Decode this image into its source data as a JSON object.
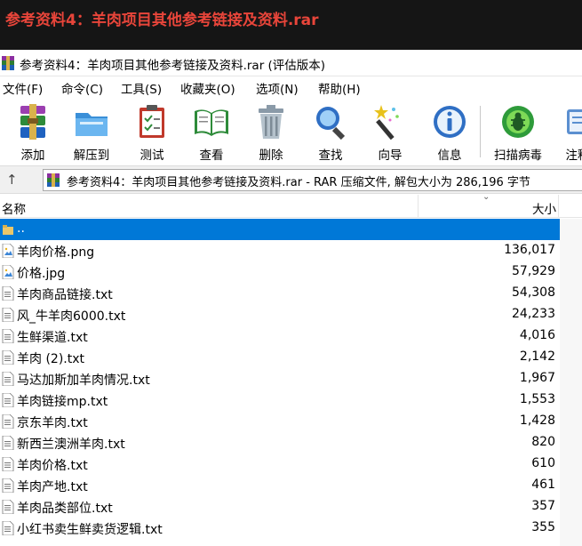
{
  "banner": {
    "title": "参考资料4：羊肉项目其他参考链接及资料.rar"
  },
  "window": {
    "title": "参考资料4：羊肉项目其他参考链接及资料.rar (评估版本)"
  },
  "menu": [
    {
      "label": "文件(F)"
    },
    {
      "label": "命令(C)"
    },
    {
      "label": "工具(S)"
    },
    {
      "label": "收藏夹(O)"
    },
    {
      "label": "选项(N)"
    },
    {
      "label": "帮助(H)"
    }
  ],
  "toolbar": [
    {
      "label": "添加",
      "icon": "add-archive-icon"
    },
    {
      "label": "解压到",
      "icon": "extract-folder-icon"
    },
    {
      "label": "测试",
      "icon": "test-clipboard-icon"
    },
    {
      "label": "查看",
      "icon": "view-book-icon"
    },
    {
      "label": "删除",
      "icon": "delete-trash-icon"
    },
    {
      "label": "查找",
      "icon": "find-magnifier-icon"
    },
    {
      "label": "向导",
      "icon": "wizard-wand-icon"
    },
    {
      "label": "信息",
      "icon": "info-icon"
    },
    {
      "label": "扫描病毒",
      "icon": "scan-virus-bug-icon"
    },
    {
      "label": "注释",
      "icon": "comment-icon"
    }
  ],
  "address": {
    "text": "参考资料4：羊肉项目其他参考链接及资料.rar - RAR 压缩文件, 解包大小为 286,196 字节"
  },
  "columns": {
    "name": "名称",
    "size": "大小"
  },
  "files": [
    {
      "name": "..",
      "size": "",
      "type": "parent"
    },
    {
      "name": "羊肉价格.png",
      "size": "136,017",
      "type": "image"
    },
    {
      "name": "价格.jpg",
      "size": "57,929",
      "type": "image"
    },
    {
      "name": "羊肉商品链接.txt",
      "size": "54,308",
      "type": "text"
    },
    {
      "name": "风_牛羊肉6000.txt",
      "size": "24,233",
      "type": "text"
    },
    {
      "name": "生鲜渠道.txt",
      "size": "4,016",
      "type": "text"
    },
    {
      "name": "羊肉 (2).txt",
      "size": "2,142",
      "type": "text"
    },
    {
      "name": "马达加斯加羊肉情况.txt",
      "size": "1,967",
      "type": "text"
    },
    {
      "name": "羊肉链接mp.txt",
      "size": "1,553",
      "type": "text"
    },
    {
      "name": "京东羊肉.txt",
      "size": "1,428",
      "type": "text"
    },
    {
      "name": "新西兰澳洲羊肉.txt",
      "size": "820",
      "type": "text"
    },
    {
      "name": "羊肉价格.txt",
      "size": "610",
      "type": "text"
    },
    {
      "name": "羊肉产地.txt",
      "size": "461",
      "type": "text"
    },
    {
      "name": "羊肉品类部位.txt",
      "size": "357",
      "type": "text"
    },
    {
      "name": "小红书卖生鲜卖货逻辑.txt",
      "size": "355",
      "type": "text"
    }
  ],
  "colors": {
    "selection": "#0078d7",
    "banner_text": "#e8453a"
  }
}
